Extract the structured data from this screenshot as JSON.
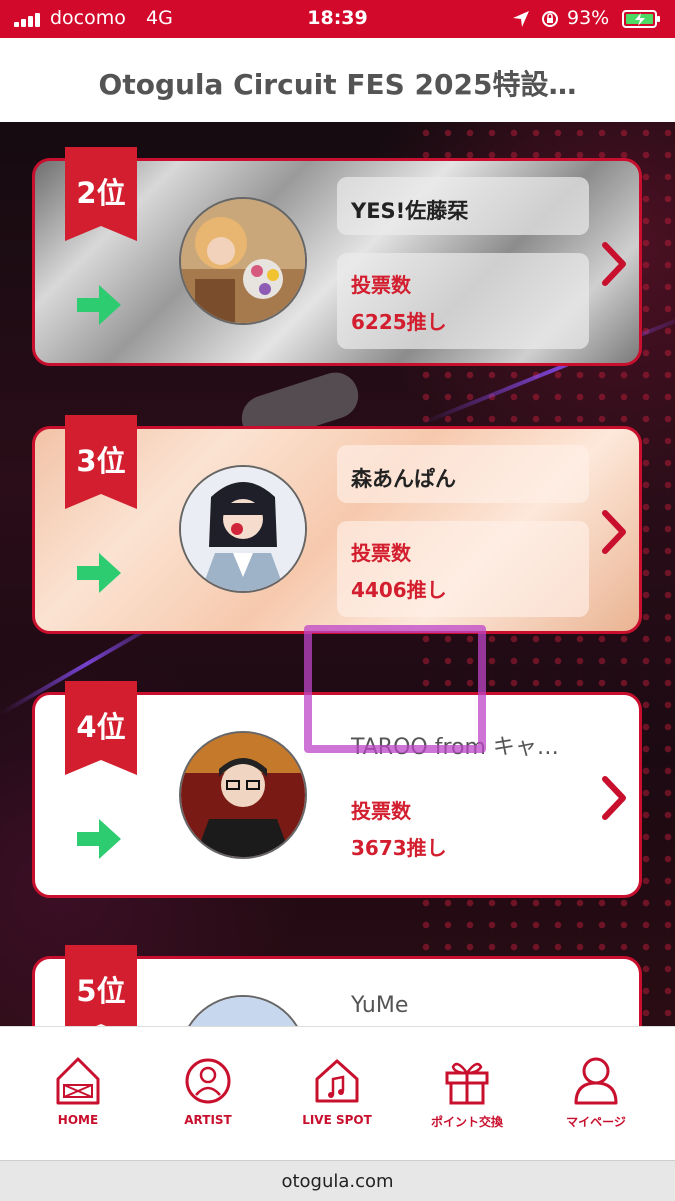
{
  "status": {
    "carrier": "docomo",
    "network": "4G",
    "time": "18:39",
    "battery": "93%"
  },
  "title": "Otogula Circuit FES 2025特設…",
  "ranking": [
    {
      "rank": "2位",
      "name": "YES!佐藤栞",
      "vote_label": "投票数",
      "votes": "6225推し",
      "style": "silver",
      "trend": "flat"
    },
    {
      "rank": "3位",
      "name": "森あんぱん",
      "vote_label": "投票数",
      "votes": "4406推し",
      "style": "bronze",
      "trend": "flat"
    },
    {
      "rank": "4位",
      "name": "TAROO from キャ…",
      "vote_label": "投票数",
      "votes": "3673推し",
      "style": "white",
      "trend": "flat"
    },
    {
      "rank": "5位",
      "name": "YuMe",
      "style": "white"
    }
  ],
  "tabs": [
    {
      "label": "HOME",
      "icon": "home-icon"
    },
    {
      "label": "ARTIST",
      "icon": "person-icon"
    },
    {
      "label": "LIVE SPOT",
      "icon": "music-house-icon"
    },
    {
      "label": "ポイント交換",
      "icon": "gift-icon"
    },
    {
      "label": "マイページ",
      "icon": "user-icon"
    }
  ],
  "url": "otogula.com",
  "colors": {
    "brand_red": "#c8102e",
    "status_bar": "#d3092b",
    "trend_green": "#2ecc71"
  }
}
